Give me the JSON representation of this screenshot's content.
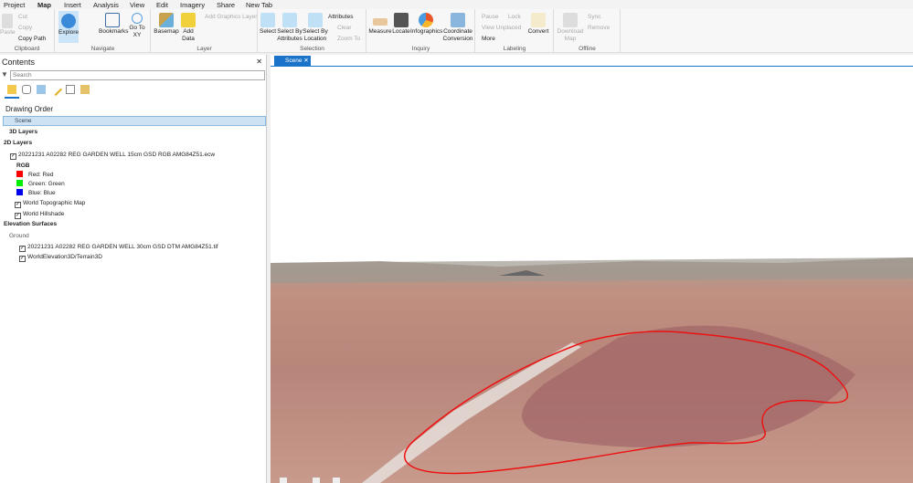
{
  "tabs": [
    "Project",
    "Map",
    "Insert",
    "Analysis",
    "View",
    "Edit",
    "Imagery",
    "Share",
    "New Tab"
  ],
  "ribbon": {
    "clipboard": {
      "label": "Clipboard",
      "paste": "Paste",
      "cut": "Cut",
      "copy": "Copy",
      "copy_path": "Copy Path"
    },
    "navigate": {
      "label": "Navigate",
      "explore": "Explore",
      "bookmarks": "Bookmarks",
      "goto": "Go To XY"
    },
    "layer": {
      "label": "Layer",
      "basemap": "Basemap",
      "add_data": "Add Data",
      "add_graphics": "Add Graphics Layer"
    },
    "selection": {
      "label": "Selection",
      "select": "Select",
      "by_attr": "Select By Attributes",
      "by_loc": "Select By Location",
      "attributes": "Attributes",
      "clear": "Clear",
      "zoom_to": "Zoom To"
    },
    "inquiry": {
      "label": "Inquiry",
      "measure": "Measure",
      "locate": "Locate",
      "infographics": "Infographics",
      "coord": "Coordinate Conversion"
    },
    "labeling": {
      "label": "Labeling",
      "pause": "Pause",
      "lock": "Lock",
      "view_unplaced": "View Unplaced",
      "more": "More",
      "convert": "Convert"
    },
    "offline": {
      "label": "Offline",
      "download": "Download Map",
      "sync": "Sync",
      "remove": "Remove"
    }
  },
  "contents": {
    "title": "Contents",
    "search_placeholder": "Search",
    "drawing_order": "Drawing Order",
    "scene": "Scene",
    "layers3d": "3D Layers",
    "layers2d": "2D Layers",
    "ecw": "20221231 A02282 REG GARDEN WELL 15cm GSD RGB AMG84Z51.ecw",
    "rgb": "RGB",
    "bands": [
      {
        "label": "Red:   Red",
        "color": "#ff0000"
      },
      {
        "label": "Green: Green",
        "color": "#00ee00"
      },
      {
        "label": "Blue:  Blue",
        "color": "#0000ee"
      }
    ],
    "topo": "World Topographic Map",
    "hillshade": "World Hillshade",
    "elev": "Elevation Surfaces",
    "ground": "Ground",
    "dtm": "20221231 A02282 REG GARDEN WELL 30cm GSD DTM AMG84Z51.tif",
    "terrain": "WorldElevation3D/Terrain3D"
  },
  "view": {
    "tab": "Scene",
    "outline_color": "#ee1111"
  }
}
